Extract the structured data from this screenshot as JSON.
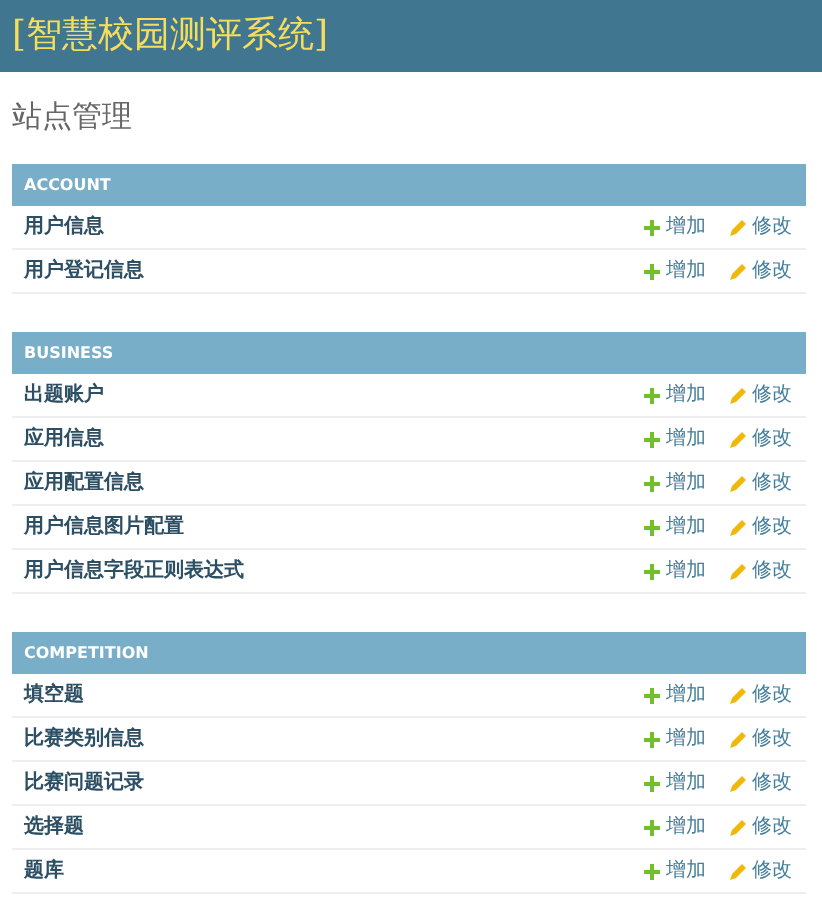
{
  "header": {
    "title": "[智慧校园测评系统]"
  },
  "page_title": "站点管理",
  "modules": [
    {
      "caption": "ACCOUNT",
      "models": [
        {
          "name": "用户信息",
          "add": "增加",
          "change": "修改"
        },
        {
          "name": "用户登记信息",
          "add": "增加",
          "change": "修改"
        }
      ]
    },
    {
      "caption": "BUSINESS",
      "models": [
        {
          "name": "出题账户",
          "add": "增加",
          "change": "修改"
        },
        {
          "name": "应用信息",
          "add": "增加",
          "change": "修改"
        },
        {
          "name": "应用配置信息",
          "add": "增加",
          "change": "修改"
        },
        {
          "name": "用户信息图片配置",
          "add": "增加",
          "change": "修改"
        },
        {
          "name": "用户信息字段正则表达式",
          "add": "增加",
          "change": "修改"
        }
      ]
    },
    {
      "caption": "COMPETITION",
      "models": [
        {
          "name": "填空题",
          "add": "增加",
          "change": "修改"
        },
        {
          "name": "比赛类别信息",
          "add": "增加",
          "change": "修改"
        },
        {
          "name": "比赛问题记录",
          "add": "增加",
          "change": "修改"
        },
        {
          "name": "选择题",
          "add": "增加",
          "change": "修改"
        },
        {
          "name": "题库",
          "add": "增加",
          "change": "修改"
        }
      ]
    }
  ]
}
